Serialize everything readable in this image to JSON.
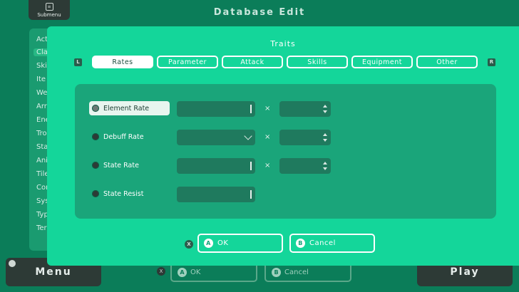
{
  "background": {
    "submenu_label": "Submenu",
    "title": "Database Edit",
    "sidebar": [
      "Act",
      "Cla",
      "Ski",
      "Ite",
      "We",
      "Arr",
      "Ene",
      "Tro",
      "Sta",
      "Ani",
      "Tile",
      "Con",
      "Sys",
      "Typ",
      "Ter"
    ],
    "menu_label": "Menu",
    "play_label": "Play",
    "x_key": "X",
    "ok_key": "A",
    "ok_label": "OK",
    "cancel_key": "B",
    "cancel_label": "Cancel"
  },
  "dialog": {
    "title": "Traits",
    "left_shoulder": "L",
    "right_shoulder": "R",
    "tabs": [
      "Rates",
      "Parameter",
      "Attack",
      "Skills",
      "Equipment",
      "Other"
    ],
    "active_tab": "Rates",
    "rows": [
      {
        "label": "Element Rate",
        "selected": true
      },
      {
        "label": "Debuff Rate",
        "selected": false
      },
      {
        "label": "State Rate",
        "selected": false
      },
      {
        "label": "State Resist",
        "selected": false
      }
    ],
    "multiply_symbol": "×",
    "x_key": "X",
    "ok_key": "A",
    "ok_label": "OK",
    "cancel_key": "B",
    "cancel_label": "Cancel"
  },
  "colors": {
    "background": "#0b7d59",
    "dialog": "#14d69a",
    "panel": "#1aa57a",
    "field": "#1f7a5e"
  }
}
